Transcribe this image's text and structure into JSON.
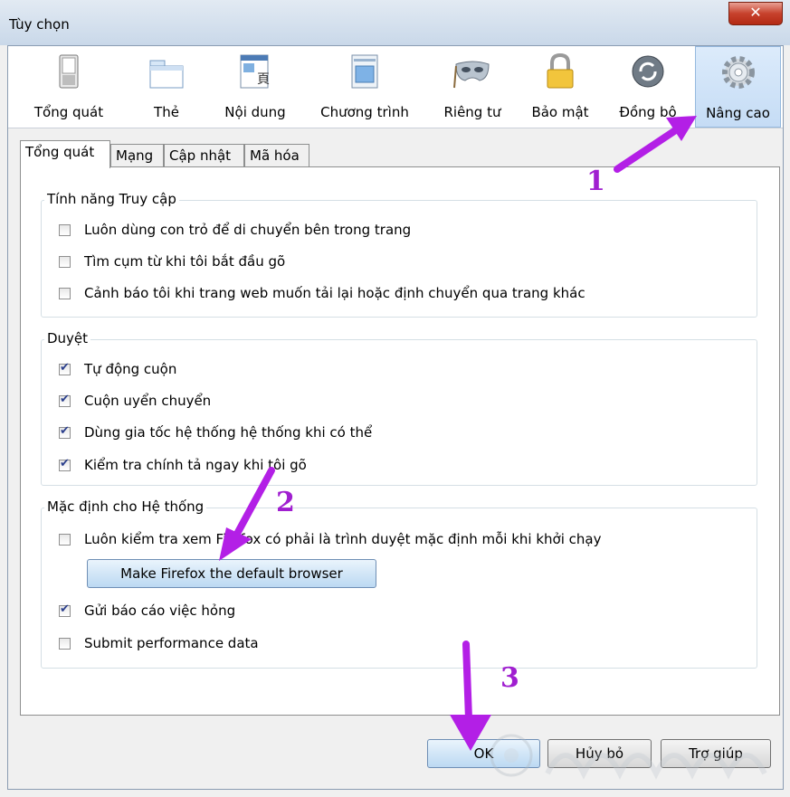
{
  "window": {
    "title": "Tùy chọn",
    "close_icon": "close-x-icon"
  },
  "toolbar": {
    "items": [
      {
        "label": "Tổng quát",
        "icon": "switch-icon"
      },
      {
        "label": "Thẻ",
        "icon": "tabs-icon"
      },
      {
        "label": "Nội dung",
        "icon": "content-icon"
      },
      {
        "label": "Chương trình",
        "icon": "applications-icon"
      },
      {
        "label": "Riêng tư",
        "icon": "mask-icon"
      },
      {
        "label": "Bảo mật",
        "icon": "lock-icon"
      },
      {
        "label": "Đồng bộ",
        "icon": "sync-icon"
      },
      {
        "label": "Nâng cao",
        "icon": "gear-icon",
        "selected": true
      }
    ]
  },
  "tabs": [
    {
      "label": "Tổng quát",
      "active": true
    },
    {
      "label": "Mạng"
    },
    {
      "label": "Cập nhật"
    },
    {
      "label": "Mã hóa"
    }
  ],
  "groups": {
    "accessibility": {
      "legend": "Tính năng Truy cập",
      "items": [
        {
          "label": "Luôn dùng con trỏ để di chuyển bên trong trang",
          "checked": false
        },
        {
          "label": "Tìm cụm từ khi tôi bắt đầu gõ",
          "checked": false
        },
        {
          "label": "Cảnh báo tôi khi trang web muốn tải lại hoặc định chuyển qua trang khác",
          "checked": false
        }
      ]
    },
    "browsing": {
      "legend": "Duyệt",
      "items": [
        {
          "label": "Tự động cuộn",
          "checked": true
        },
        {
          "label": "Cuộn uyển chuyển",
          "checked": true
        },
        {
          "label": "Dùng gia tốc hệ thống hệ thống khi có thể",
          "checked": true
        },
        {
          "label": "Kiểm tra chính tả ngay khi tôi gõ",
          "checked": true
        }
      ]
    },
    "system_defaults": {
      "legend": "Mặc định cho Hệ thống",
      "items": [
        {
          "label": "Luôn kiểm tra xem Firefox có phải là trình duyệt mặc định mỗi khi khởi chạy",
          "checked": false
        },
        {
          "label": "Gửi báo cáo việc hỏng",
          "checked": true
        },
        {
          "label": "Submit performance data",
          "checked": false
        }
      ],
      "default_button": "Make Firefox the default browser"
    }
  },
  "footer": {
    "ok": "OK",
    "cancel": "Hủy bỏ",
    "help": "Trợ giúp"
  },
  "annotations": {
    "step1": "1",
    "step2": "2",
    "step3": "3",
    "arrow_color": "#b31fe6"
  },
  "colors": {
    "selected_toolbar_bg": "#c5dcf5",
    "close_button": "#c7412c",
    "check_color": "#2b3f8c"
  }
}
